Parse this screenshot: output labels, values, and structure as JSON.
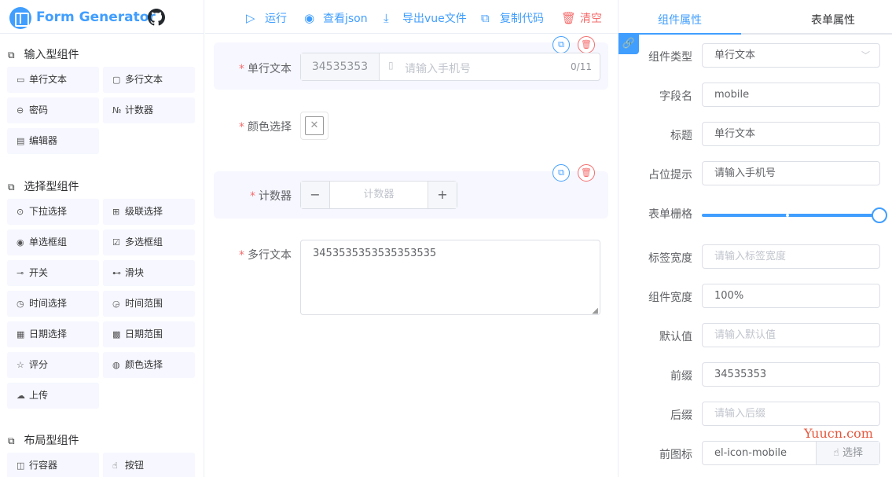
{
  "app": {
    "title": "Form Generator"
  },
  "toolbar": {
    "run": "运行",
    "view_json": "查看json",
    "export_vue": "导出vue文件",
    "copy_code": "复制代码",
    "clear": "清空"
  },
  "groups": {
    "input": {
      "title": "输入型组件",
      "items": [
        "单行文本",
        "多行文本",
        "密码",
        "计数器",
        "编辑器"
      ]
    },
    "select": {
      "title": "选择型组件",
      "items": [
        "下拉选择",
        "级联选择",
        "单选框组",
        "多选框组",
        "开关",
        "滑块",
        "时间选择",
        "时间范围",
        "日期选择",
        "日期范围",
        "评分",
        "颜色选择",
        "上传"
      ]
    },
    "layout": {
      "title": "布局型组件",
      "items": [
        "行容器",
        "按钮"
      ]
    }
  },
  "canvas": {
    "fields": [
      {
        "label": "单行文本",
        "prepend": "34535353",
        "placeholder": "请输入手机号",
        "count": "0/11"
      },
      {
        "label": "颜色选择"
      },
      {
        "label": "计数器",
        "placeholder": "计数器",
        "minus": "−",
        "plus": "+"
      },
      {
        "label": "多行文本",
        "value": "3453535353535353535"
      }
    ]
  },
  "props_panel": {
    "tabs": [
      "组件属性",
      "表单属性"
    ],
    "active_tab": "组件属性",
    "rows": [
      {
        "label": "组件类型",
        "value": "单行文本",
        "placeholder": ""
      },
      {
        "label": "字段名",
        "value": "mobile",
        "placeholder": ""
      },
      {
        "label": "标题",
        "value": "单行文本",
        "placeholder": ""
      },
      {
        "label": "占位提示",
        "value": "请输入手机号",
        "placeholder": ""
      },
      {
        "label": "表单栅格",
        "value": "",
        "placeholder": ""
      },
      {
        "label": "标签宽度",
        "value": "",
        "placeholder": "请输入标签宽度"
      },
      {
        "label": "组件宽度",
        "value": "100%",
        "placeholder": ""
      },
      {
        "label": "默认值",
        "value": "",
        "placeholder": "请输入默认值"
      },
      {
        "label": "前缀",
        "value": "34535353",
        "placeholder": ""
      },
      {
        "label": "后缀",
        "value": "",
        "placeholder": "请输入后缀"
      },
      {
        "label": "前图标",
        "value": "el-icon-mobile",
        "placeholder": ""
      }
    ],
    "grid_span": 24,
    "icon_select_button": "选择"
  },
  "watermark": "Yuucn.com",
  "colors": {
    "primary": "#409eff",
    "danger": "#f56c6c",
    "item_bg": "#f6f7ff"
  }
}
